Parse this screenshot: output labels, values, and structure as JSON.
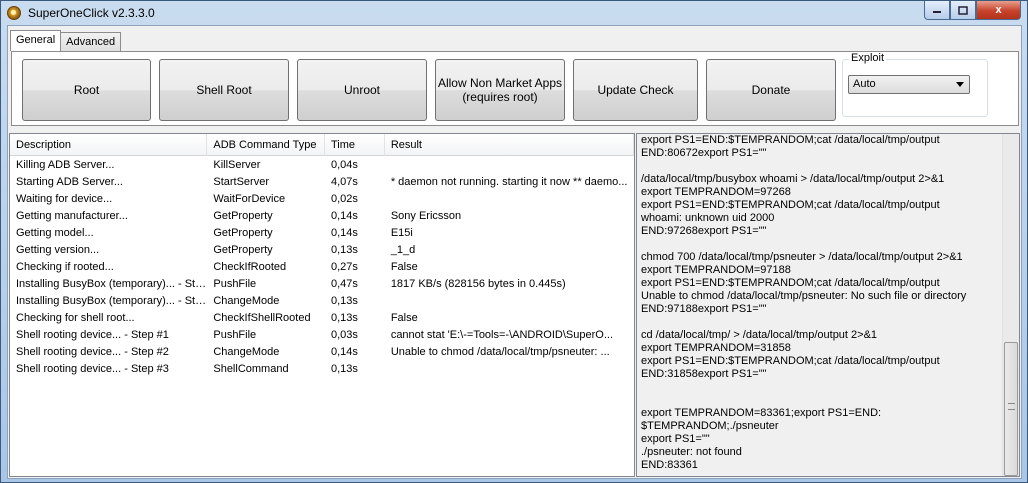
{
  "window": {
    "title": "SuperOneClick v2.3.3.0",
    "close_label": "x"
  },
  "tabs": [
    "General",
    "Advanced"
  ],
  "buttons": {
    "root": "Root",
    "shell_root": "Shell Root",
    "unroot": "Unroot",
    "allow_line1": "Allow Non Market Apps",
    "allow_line2": "(requires root)",
    "update_check": "Update Check",
    "donate": "Donate"
  },
  "exploit": {
    "label": "Exploit",
    "value": "Auto"
  },
  "table": {
    "columns": [
      "Description",
      "ADB Command Type",
      "Time",
      "Result"
    ],
    "rows": [
      [
        "Killing ADB Server...",
        "KillServer",
        "0,04s",
        ""
      ],
      [
        "Starting ADB Server...",
        "StartServer",
        "4,07s",
        "* daemon not running. starting it now ** daemo..."
      ],
      [
        "Waiting for device...",
        "WaitForDevice",
        "0,02s",
        ""
      ],
      [
        "Getting manufacturer...",
        "GetProperty",
        "0,14s",
        "Sony Ericsson"
      ],
      [
        "Getting model...",
        "GetProperty",
        "0,14s",
        "E15i"
      ],
      [
        "Getting version...",
        "GetProperty",
        "0,13s",
        "_1_d"
      ],
      [
        "Checking if rooted...",
        "CheckIfRooted",
        "0,27s",
        "False"
      ],
      [
        "Installing BusyBox (temporary)... - Step...",
        "PushFile",
        "0,47s",
        "1817 KB/s (828156 bytes in 0.445s)"
      ],
      [
        "Installing BusyBox (temporary)... - Step...",
        "ChangeMode",
        "0,13s",
        ""
      ],
      [
        "Checking for shell root...",
        "CheckIfShellRooted",
        "0,13s",
        "False"
      ],
      [
        "Shell rooting device... - Step #1",
        "PushFile",
        "0,03s",
        "cannot stat 'E:\\-=Tools=-\\ANDROID\\SuperO..."
      ],
      [
        "Shell rooting device... - Step #2",
        "ChangeMode",
        "0,14s",
        "Unable to chmod /data/local/tmp/psneuter: ..."
      ],
      [
        "Shell rooting device... - Step #3",
        "ShellCommand",
        "0,13s",
        ""
      ]
    ]
  },
  "log": "export PS1=END:$TEMPRANDOM;cat /data/local/tmp/output\nEND:80672export PS1=\"\"\n\n/data/local/tmp/busybox whoami > /data/local/tmp/output 2>&1\nexport TEMPRANDOM=97268\nexport PS1=END:$TEMPRANDOM;cat /data/local/tmp/output\nwhoami: unknown uid 2000\nEND:97268export PS1=\"\"\n\nchmod 700 /data/local/tmp/psneuter > /data/local/tmp/output 2>&1\nexport TEMPRANDOM=97188\nexport PS1=END:$TEMPRANDOM;cat /data/local/tmp/output\nUnable to chmod /data/local/tmp/psneuter: No such file or directory\nEND:97188export PS1=\"\"\n\ncd /data/local/tmp/ > /data/local/tmp/output 2>&1\nexport TEMPRANDOM=31858\nexport PS1=END:$TEMPRANDOM;cat /data/local/tmp/output\nEND:31858export PS1=\"\"\n\n\nexport TEMPRANDOM=83361;export PS1=END:\n$TEMPRANDOM;./psneuter\nexport PS1=\"\"\n./psneuter: not found\nEND:83361"
}
